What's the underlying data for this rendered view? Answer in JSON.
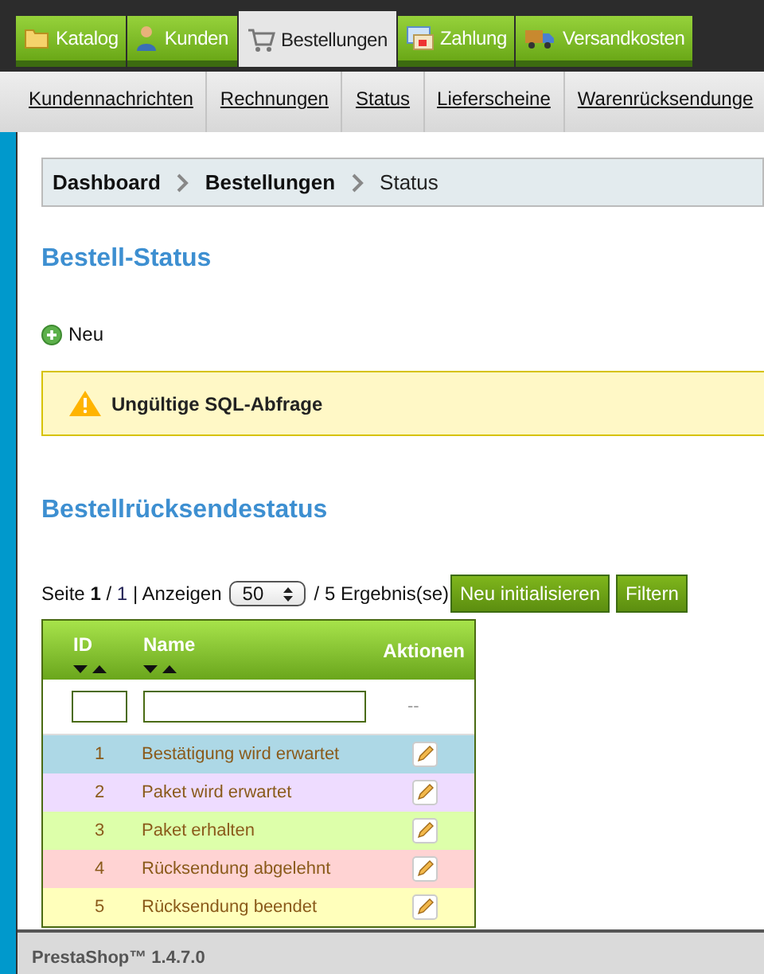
{
  "tabs": [
    {
      "label": "Katalog",
      "kind": "folder",
      "selected": false
    },
    {
      "label": "Kunden",
      "kind": "person",
      "selected": false
    },
    {
      "label": "Bestellungen",
      "kind": "cart",
      "selected": true
    },
    {
      "label": "Zahlung",
      "kind": "card",
      "selected": false
    },
    {
      "label": "Versandkosten",
      "kind": "truck",
      "selected": false
    }
  ],
  "subnav": [
    "Kundennachrichten",
    "Rechnungen",
    "Status",
    "Lieferscheine",
    "Warenrücksendunge"
  ],
  "breadcrumb": [
    {
      "label": "Dashboard",
      "current": false
    },
    {
      "label": "Bestellungen",
      "current": false
    },
    {
      "label": "Status",
      "current": true
    }
  ],
  "heading": "Bestell-Status",
  "new_link": "Neu",
  "warning": "Ungültige SQL-Abfrage",
  "heading2": "Bestellrücksendestatus",
  "pagination": {
    "page": "Seite",
    "current": "1",
    "sep": "/",
    "total": "1",
    "show": "| Anzeigen",
    "per_page": "50",
    "results": "/ 5 Ergebnis(se)"
  },
  "buttons": [
    "Neu initialisieren",
    "Filtern"
  ],
  "table": {
    "columns": [
      "ID",
      "Name",
      "Aktionen"
    ],
    "filter_placeholder": "--",
    "rows": [
      {
        "id": "1",
        "name": "Bestätigung wird erwartet",
        "color": "#add8e6"
      },
      {
        "id": "2",
        "name": "Paket wird erwartet",
        "color": "#eedcff"
      },
      {
        "id": "3",
        "name": "Paket erhalten",
        "color": "#ddffaa"
      },
      {
        "id": "4",
        "name": "Rücksendung abgelehnt",
        "color": "#ffd3d3"
      },
      {
        "id": "5",
        "name": "Rücksendung beendet",
        "color": "#ffffbb"
      }
    ]
  },
  "footer": "PrestaShop™ 1.4.7.0"
}
